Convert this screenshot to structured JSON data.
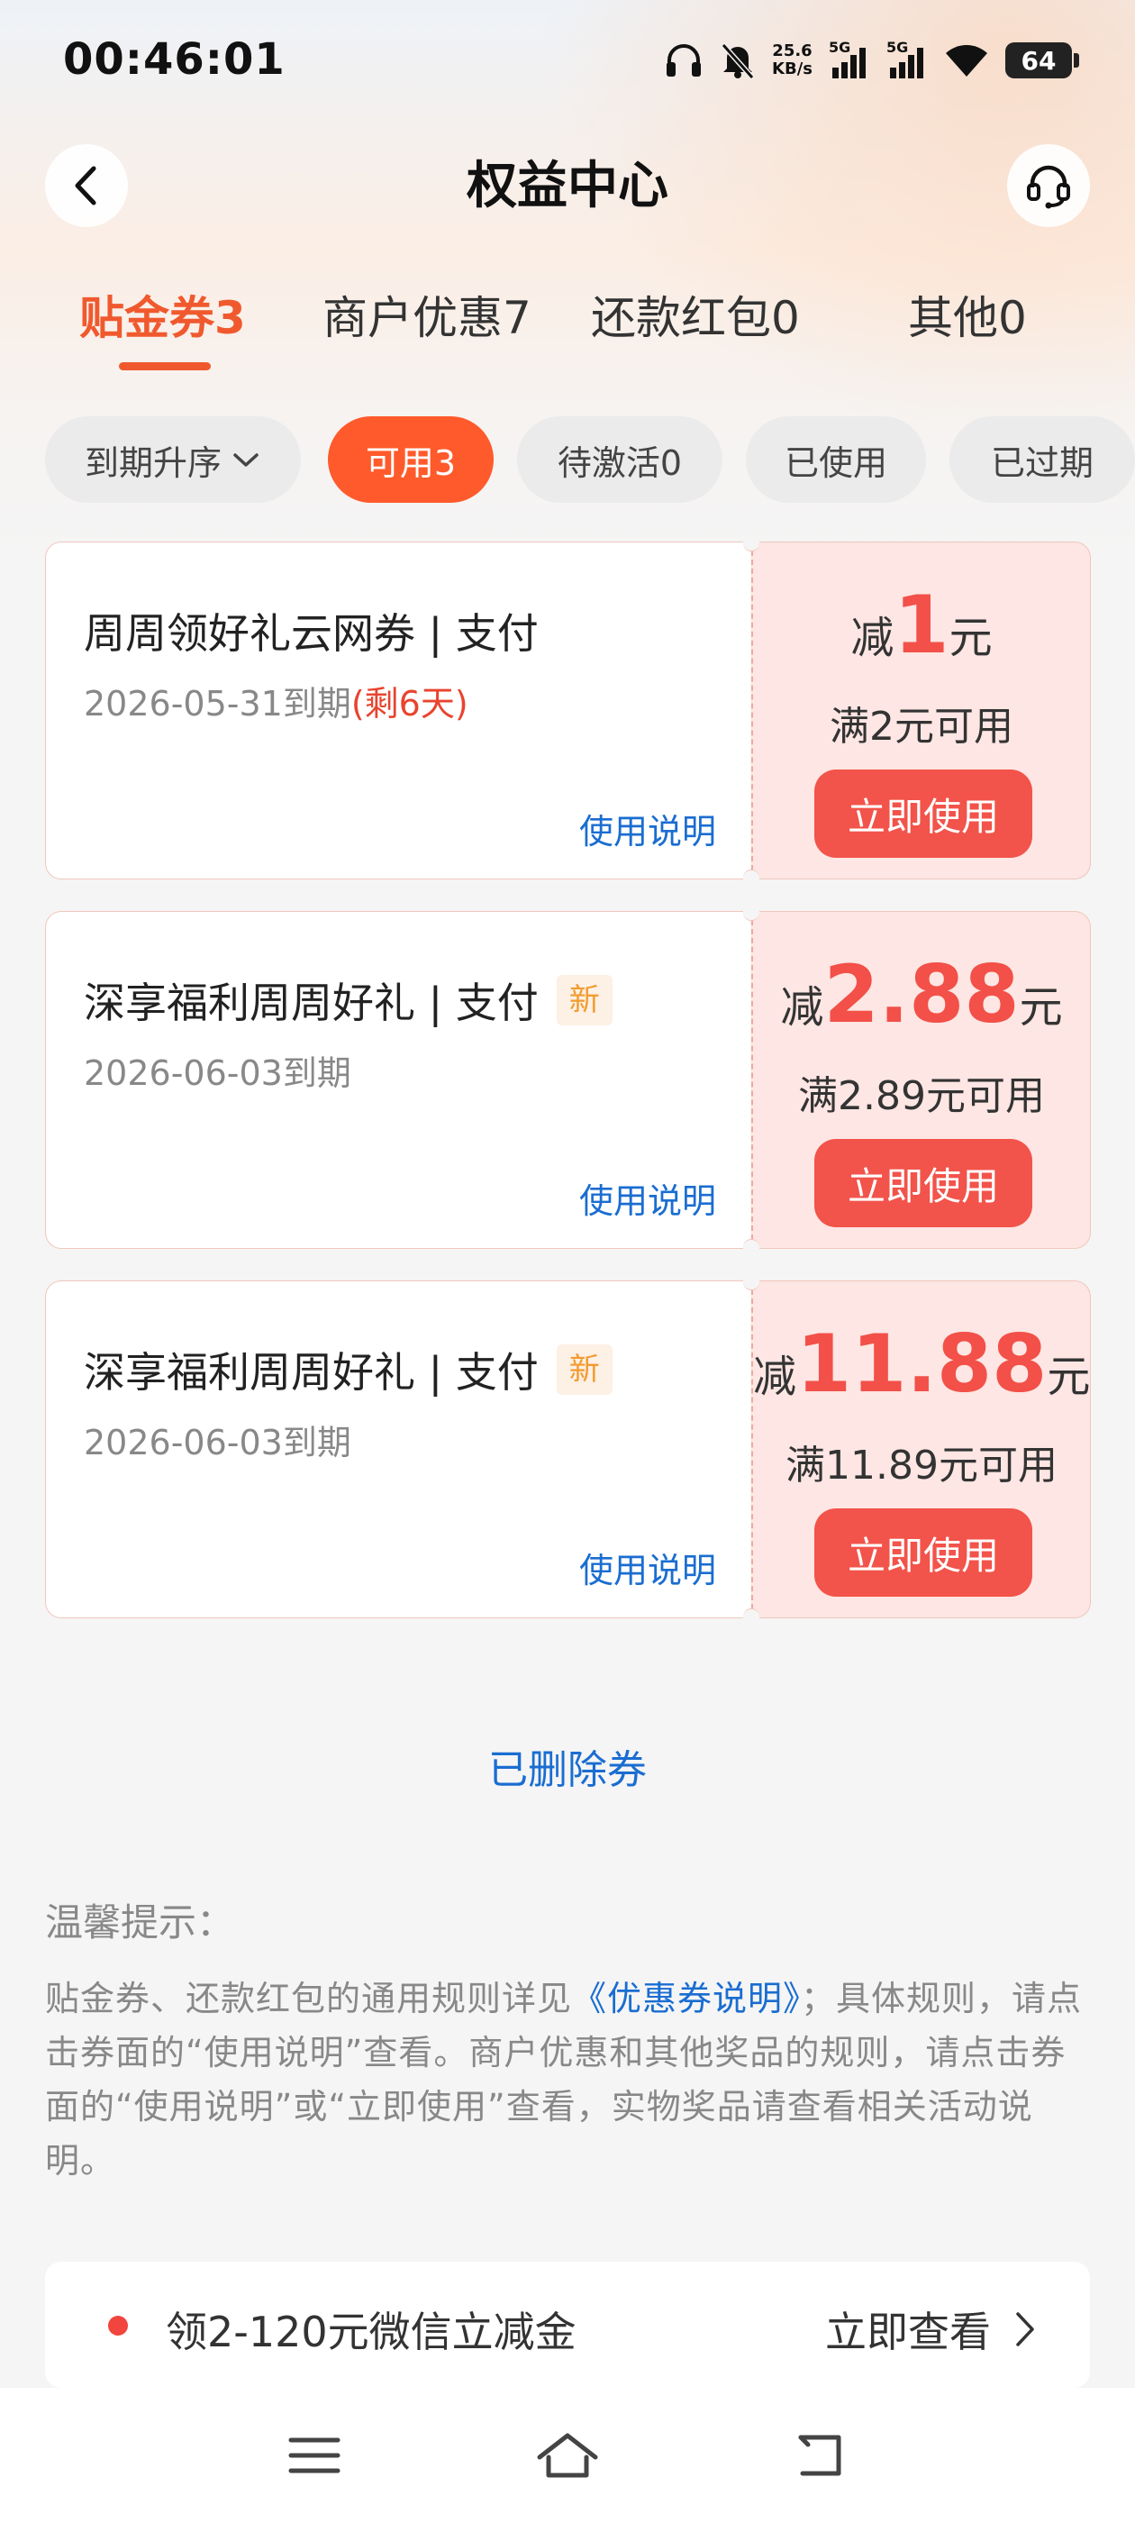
{
  "status_bar": {
    "time": "00:46:01",
    "net_speed_value": "25.6",
    "net_speed_unit": "KB/s",
    "sim1": "5G",
    "sim2": "5G",
    "battery": "64"
  },
  "header": {
    "title": "权益中心"
  },
  "tabs": [
    {
      "label": "贴金券3",
      "active": true
    },
    {
      "label": "商户优惠7",
      "active": false
    },
    {
      "label": "还款红包0",
      "active": false
    },
    {
      "label": "其他0",
      "active": false
    }
  ],
  "filters": {
    "sort_label": "到期升序",
    "chips": [
      {
        "label": "可用3",
        "active": true
      },
      {
        "label": "待激活0",
        "active": false
      },
      {
        "label": "已使用",
        "active": false
      },
      {
        "label": "已过期",
        "active": false
      }
    ]
  },
  "coupons": [
    {
      "title": "周周领好礼云网券 | 支付",
      "badge": "",
      "date": "2026-05-31到期",
      "remaining": "(剩6天)",
      "explain": "使用说明",
      "prefix": "减",
      "amount": "1",
      "unit": "元",
      "min_spend": "满2元可用",
      "use_label": "立即使用"
    },
    {
      "title": "深享福利周周好礼 | 支付",
      "badge": "新",
      "date": "2026-06-03到期",
      "remaining": "",
      "explain": "使用说明",
      "prefix": "减",
      "amount": "2.88",
      "unit": "元",
      "min_spend": "满2.89元可用",
      "use_label": "立即使用"
    },
    {
      "title": "深享福利周周好礼 | 支付",
      "badge": "新",
      "date": "2026-06-03到期",
      "remaining": "",
      "explain": "使用说明",
      "prefix": "减",
      "amount": "11.88",
      "unit": "元",
      "min_spend": "满11.89元可用",
      "use_label": "立即使用"
    }
  ],
  "deleted_link": "已删除券",
  "tips": {
    "title": "温馨提示：",
    "body_1": "贴金券、还款红包的通用规则详见",
    "body_link": "《优惠券说明》",
    "body_2": "；具体规则，请点击券面的“使用说明”查看。商户优惠和其他奖品的规则，请点击券面的“使用说明”或“立即使用”查看，实物奖品请查看相关活动说明。"
  },
  "promo": {
    "text": "领2-120元微信立减金",
    "cta": "立即查看"
  },
  "colors": {
    "accent": "#f0592e",
    "chip_active": "#ff5a2b",
    "coupon_red": "#f25048",
    "link_blue": "#1a6dd1"
  }
}
